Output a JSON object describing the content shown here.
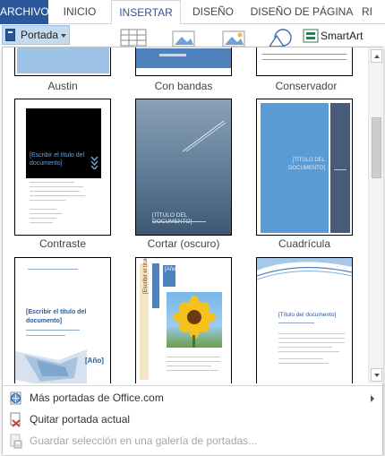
{
  "tabs": [
    {
      "label": "ARCHIVO"
    },
    {
      "label": "INICIO"
    },
    {
      "label": "INSERTAR"
    },
    {
      "label": "DISEÑO"
    },
    {
      "label": "DISEÑO DE PÁGINA"
    },
    {
      "label": "RI"
    }
  ],
  "ribbon": {
    "portada_label": "Portada",
    "smartart_label": "SmartArt"
  },
  "gallery": {
    "covers": [
      {
        "name": "Austin"
      },
      {
        "name": "Con bandas"
      },
      {
        "name": "Conservador"
      },
      {
        "name": "Contraste",
        "title_text": "[Escribir el título del documento]"
      },
      {
        "name": "Cortar (oscuro)",
        "title_text": "[TÍTULO DEL DOCUMENTO]"
      },
      {
        "name": "Cuadrícula",
        "title_text": "[TÍTULO DEL DOCUMENTO]"
      },
      {
        "name": "",
        "title_text": "[Escribir el título del documento]",
        "year_text": "[Año]"
      },
      {
        "name": "",
        "year_text": "[Año]"
      },
      {
        "name": "",
        "title_text": "[Título del documento]"
      }
    ]
  },
  "menu": {
    "more_covers": "Más portadas de Office.com",
    "remove_cover": "Quitar portada actual",
    "save_selection": "Guardar selección en una galería de portadas..."
  },
  "colors": {
    "file_tab": "#2b579a",
    "accent_blue": "#4f81bd",
    "dark_cover": "#000000"
  }
}
